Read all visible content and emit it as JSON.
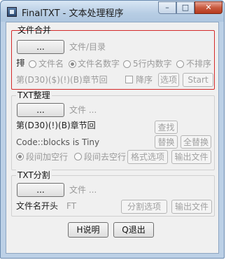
{
  "window": {
    "title": "FinalTXT - 文本处理程序",
    "minimize": "–",
    "maximize": "□",
    "close": "✕"
  },
  "merge": {
    "title": "文件合并",
    "browse": "...",
    "path_placeholder": "文件/目录",
    "sort_label": "排序",
    "options": [
      "文件名",
      "文件名数字",
      "5行内数字",
      "不排序"
    ],
    "selected": "文件名数字",
    "pattern": "第(D30)($)(!)(B)章节回",
    "desc_label": "降序",
    "options_button": "选项",
    "start_button": "Start"
  },
  "organize": {
    "title": "TXT整理",
    "browse": "...",
    "path_placeholder": "文件 ...",
    "pattern": "第(D30)(!)(B)章节回",
    "code_text": "Code::blocks is Tiny",
    "find_button": "查找",
    "replace_button": "替换",
    "replace_all_button": "全替换",
    "mode_add": "段间加空行",
    "mode_remove": "段间去空行",
    "selected_mode": "段间加空行",
    "format_button": "格式选项",
    "export_button": "输出文件"
  },
  "split": {
    "title": "TXT分割",
    "browse": "...",
    "path_placeholder": "文件 ...",
    "prefix_label": "文件名开头",
    "prefix_value": "FT",
    "options_button": "分割选项",
    "export_button": "输出文件"
  },
  "footer": {
    "help_button": "H说明",
    "quit_button": "Q退出"
  }
}
